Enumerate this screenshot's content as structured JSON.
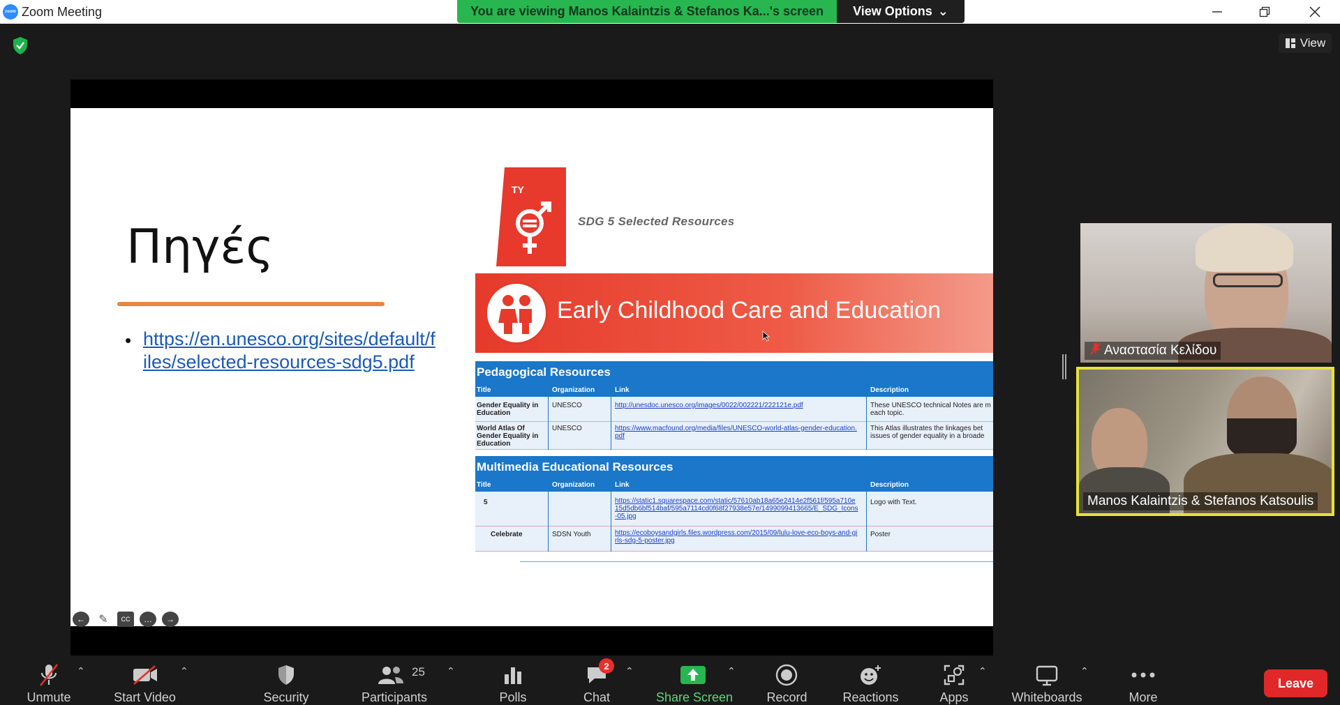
{
  "window": {
    "title": "Zoom Meeting",
    "app_logo_text": "zoom"
  },
  "share_banner": {
    "text": "You are viewing Manos Kalaintzis & Stefanos Ka...'s screen",
    "view_options_label": "View Options"
  },
  "top_right": {
    "view_label": "View"
  },
  "slide": {
    "title": "Πηγές",
    "link_text": "https://en.unesco.org/sites/default/files/selected-resources-sdg5.pdf",
    "embed": {
      "sdg_heading": "SDG 5 Selected Resources",
      "sdg_tile_text": "TY",
      "banner_text": "Early Childhood Care and Education",
      "sections": [
        {
          "title": "Pedagogical Resources",
          "headers": [
            "Title",
            "Organization",
            "Link",
            "Description"
          ],
          "rows": [
            {
              "title": "Gender Equality in Education",
              "org": "UNESCO",
              "link": "http://unesdoc.unesco.org/images/0022/002221/222121e.pdf",
              "desc": "These UNESCO technical Notes are m each topic."
            },
            {
              "title": "World Atlas Of Gender Equality in Education",
              "org": "UNESCO",
              "link": "https://www.macfound.org/media/files/UNESCO-world-atlas-gender-education.pdf",
              "desc": "This Atlas illustrates the linkages bet issues of gender equality in a broade"
            }
          ]
        },
        {
          "title": "Multimedia Educational Resources",
          "headers": [
            "Title",
            "Organization",
            "Link",
            "Description"
          ],
          "rows": [
            {
              "title": "5",
              "org": "",
              "link": "https://static1.squarespace.com/static/57610ab18a65e2414e2f561f/595a710e15d5db6bf514baf/595a7114cd0f68f27938e57e/1499099413665/E_SDG_Icons-05.jpg",
              "desc": "Logo with Text."
            },
            {
              "title": "Celebrate",
              "org": "SDSN Youth",
              "link": "https://ecoboysandgirls.files.wordpress.com/2015/09/lulu-love-eco-boys-and-girls-sdg-5-poster.jpg",
              "desc": "Poster"
            }
          ]
        }
      ]
    }
  },
  "participants_video": [
    {
      "name": "Αναστασία Κελίδου",
      "muted": true
    },
    {
      "name": "Manos Kalaintzis & Stefanos Katsoulis",
      "muted": false,
      "active_speaker": true
    }
  ],
  "toolbar": {
    "unmute": "Unmute",
    "start_video": "Start Video",
    "security": "Security",
    "participants": "Participants",
    "participants_count": "25",
    "polls": "Polls",
    "chat": "Chat",
    "chat_badge": "2",
    "share_screen": "Share Screen",
    "record": "Record",
    "reactions": "Reactions",
    "apps": "Apps",
    "whiteboards": "Whiteboards",
    "more": "More",
    "leave": "Leave"
  },
  "colors": {
    "share_banner": "#27b64f",
    "leave": "#e02828",
    "active_speaker_border": "#e5e33a",
    "share_screen_icon": "#27b64f",
    "badge": "#e5302b"
  }
}
